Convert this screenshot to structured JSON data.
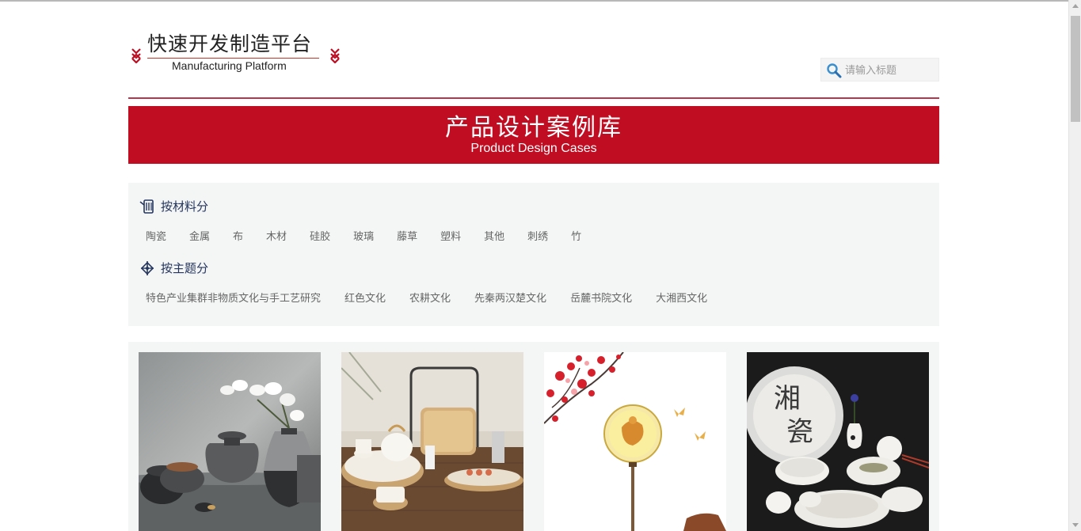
{
  "header": {
    "logo_cn": "快速开发制造平台",
    "logo_en": "Manufacturing Platform"
  },
  "search": {
    "placeholder": "请输入标题",
    "icon": "search-icon"
  },
  "banner": {
    "title_cn": "产品设计案例库",
    "title_en": "Product Design Cases"
  },
  "filters": {
    "material": {
      "title": "按材料分",
      "icon": "material-icon",
      "items": [
        "陶瓷",
        "金属",
        "布",
        "木材",
        "硅胶",
        "玻璃",
        "藤草",
        "塑料",
        "其他",
        "刺绣",
        "竹"
      ]
    },
    "theme": {
      "title": "按主题分",
      "icon": "theme-icon",
      "items": [
        "特色产业集群非物质文化与手工艺研究",
        "红色文化",
        "农耕文化",
        "先秦两汉楚文化",
        "岳麓书院文化",
        "大湘西文化"
      ]
    }
  },
  "gallery": {
    "cards": [
      {
        "image": "grey-ceramic-vases-with-orchid"
      },
      {
        "image": "bamboo-tea-set-on-wooden-table"
      },
      {
        "image": "round-fan-with-plum-blossoms"
      },
      {
        "image": "white-tableware-with-calligraphy-plate",
        "plate_text": "湘瓷"
      }
    ]
  },
  "colors": {
    "brand_red": "#c00d22",
    "divider": "#b9354e",
    "filter_title": "#24355d",
    "panel_bg": "#f4f6f6"
  }
}
